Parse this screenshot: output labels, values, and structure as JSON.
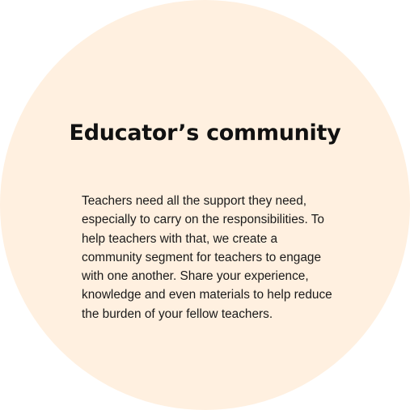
{
  "card": {
    "title": "Educator’s community",
    "description": "Teachers need all the support they need, especially to carry on the responsibilities. To help teachers with that, we create a community segment for teachers to engage with one another. Share your experience, knowledge and even materials to help reduce the burden of your fellow teachers."
  },
  "colors": {
    "circle_background": "#fff0e0",
    "title_text": "#111111",
    "body_text": "#1a1a1a"
  }
}
